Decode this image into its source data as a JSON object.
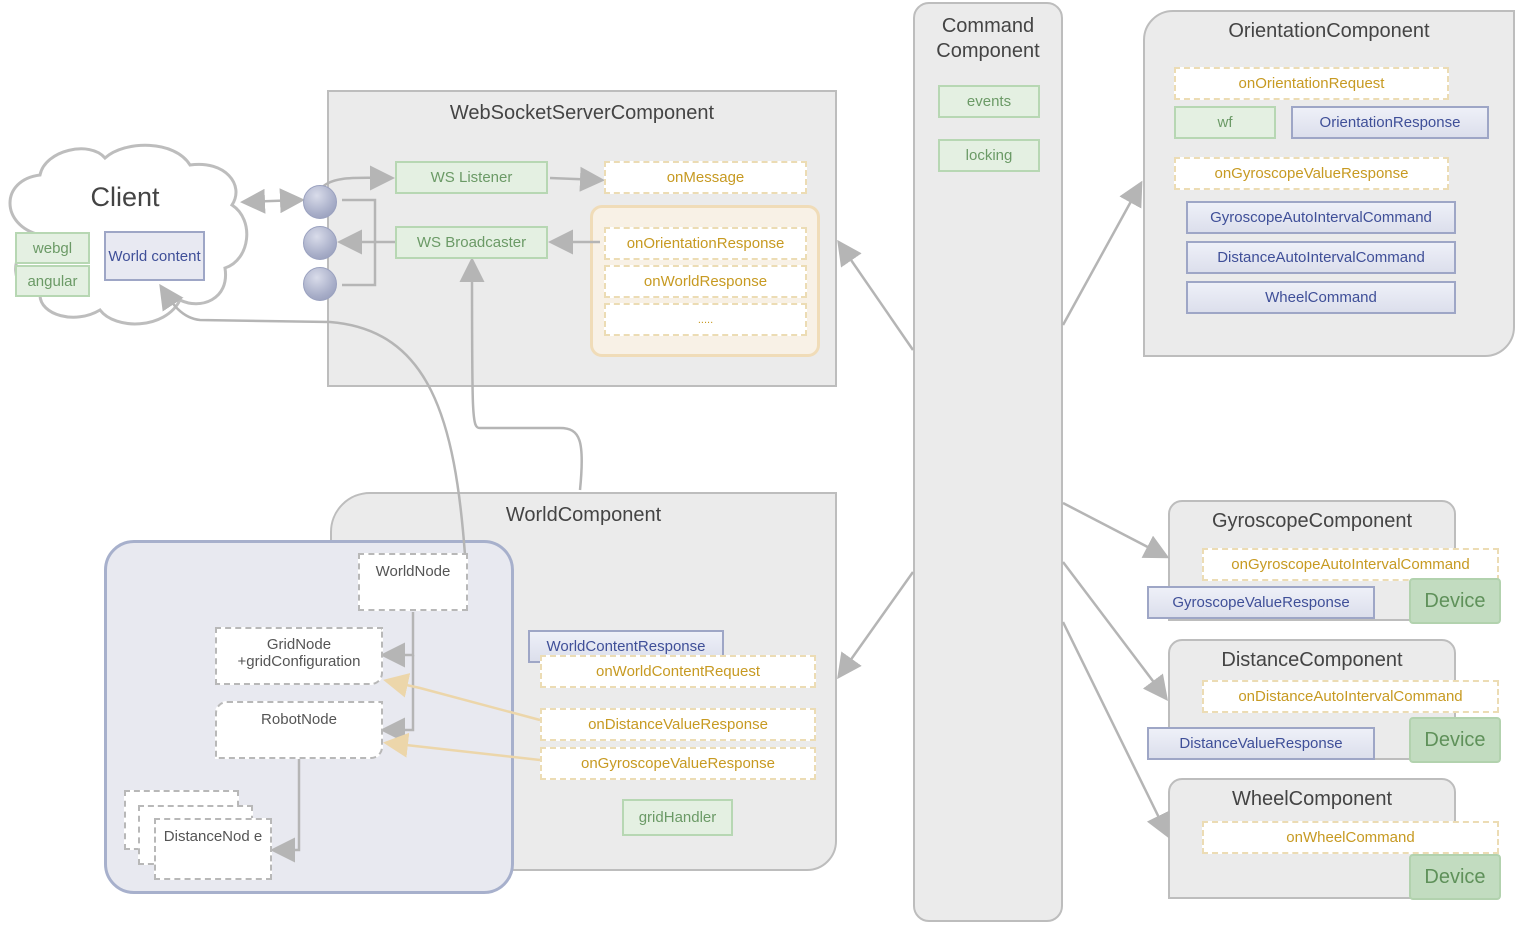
{
  "client": {
    "title": "Client",
    "webgl": "webgl",
    "angular": "angular",
    "world_content": "World content"
  },
  "websocket": {
    "title": "WebSocketServerComponent",
    "ws_listener": "WS Listener",
    "ws_broadcaster": "WS Broadcaster",
    "on_message": "onMessage",
    "on_orientation_response": "onOrientationResponse",
    "on_world_response": "onWorldResponse",
    "ellipsis": "....."
  },
  "command": {
    "title": "Command Component",
    "events": "events",
    "locking": "locking"
  },
  "orientation": {
    "title": "OrientationComponent",
    "on_orientation_request": "onOrientationRequest",
    "wf": "wf",
    "orientation_response": "OrientationResponse",
    "on_gyroscope_value_response": "onGyroscopeValueResponse",
    "gyro_auto_cmd": "GyroscopeAutoIntervalCommand",
    "distance_auto_cmd": "DistanceAutoIntervalCommand",
    "wheel_cmd": "WheelCommand"
  },
  "world": {
    "title": "WorldComponent",
    "world_node": "WorldNode",
    "grid_node": "GridNode",
    "grid_config": "+gridConfiguration",
    "robot_node": "RobotNode",
    "distance_node": "DistanceNod e",
    "world_content_response": "WorldContentResponse",
    "on_world_content_request": "onWorldContentRequest",
    "on_distance_value_response": "onDistanceValueResponse",
    "on_gyroscope_value_response": "onGyroscopeValueResponse",
    "grid_handler": "gridHandler"
  },
  "gyroscope": {
    "title": "GyroscopeComponent",
    "on_cmd": "onGyroscopeAutoIntervalCommand",
    "response": "GyroscopeValueResponse",
    "device": "Device"
  },
  "distance": {
    "title": "DistanceComponent",
    "on_cmd": "onDistanceAutoIntervalCommand",
    "response": "DistanceValueResponse",
    "device": "Device"
  },
  "wheel": {
    "title": "WheelComponent",
    "on_cmd": "onWheelCommand",
    "device": "Device"
  },
  "colors": {
    "panel": "#ebebeb",
    "green": "#e4f0e2",
    "blue": "#dcdfec",
    "yellow_border": "#ecdcb4",
    "device": "#c2dcc0",
    "arrow": "#b5b5b5"
  }
}
